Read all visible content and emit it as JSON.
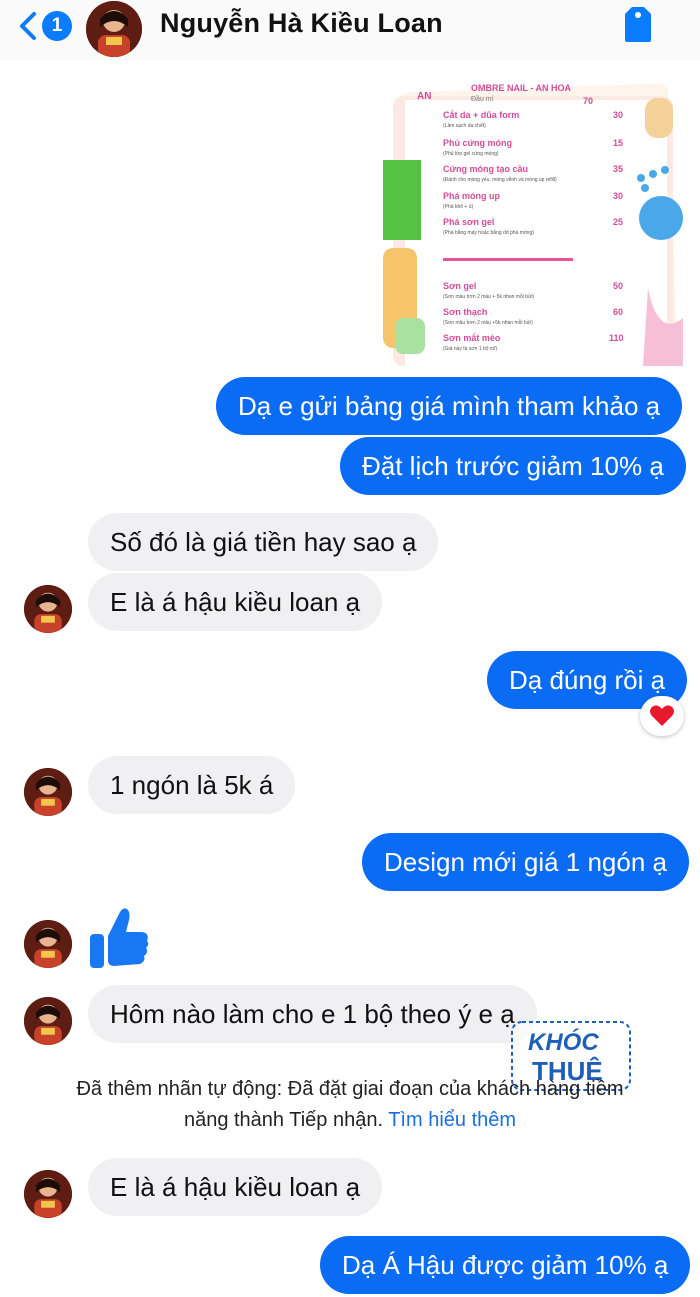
{
  "header": {
    "unread_count": "1",
    "contact_name": "Nguyễn Hà Kiều Loan",
    "back_icon": "chevron-left-icon",
    "action_icon": "tag-icon"
  },
  "price_list": {
    "header_left": "AN",
    "header_title": "OMBRE NAIL - AN HOA",
    "header_sub": "Đầu mí",
    "header_price": "70",
    "items": [
      {
        "name": "Cắt da + dũa form",
        "note": "(Làm sạch da chết)",
        "price": "30"
      },
      {
        "name": "Phủ cứng móng",
        "note": "(Phủ lớp gel cứng móng)",
        "price": "15"
      },
      {
        "name": "Cứng móng tạo cầu",
        "note": "(Đánh cho móng yếu, móng vểnh và móng up refill)",
        "price": "35"
      },
      {
        "name": "Phá móng up",
        "note": "(Phá khô + ủ)",
        "price": "30"
      },
      {
        "name": "Phá sơn gel",
        "note": "(Phá bằng máy hoặc bằng dd phá móng)",
        "price": "25"
      },
      {
        "name": "Sơn gel",
        "note": "(Sơn màu trơn 2 màu + 5k nhan mỗi bửi)",
        "price": "50"
      },
      {
        "name": "Sơn thạch",
        "note": "(Sơn màu trơn 2 màu +5k nhan mỗi bửi)",
        "price": "60"
      },
      {
        "name": "Sơn mắt mèo",
        "note": "(Giá này tà sơn 1 bộ mĩ)",
        "price": "110"
      }
    ]
  },
  "messages": [
    {
      "text": "Dạ e gửi bảng giá mình tham khảo ạ"
    },
    {
      "text": "Đặt lịch trước giảm 10% ạ"
    },
    {
      "text": "Số đó là giá tiền hay sao ạ"
    },
    {
      "text": "E là á hậu kiều loan ạ"
    },
    {
      "text": "Dạ đúng rồi ạ"
    },
    {
      "text": "1 ngón là 5k á"
    },
    {
      "text": "Design mới giá 1 ngón ạ"
    },
    {
      "text": "Hôm nào làm cho e 1 bộ theo ý e ạ"
    },
    {
      "text": "E là á hậu kiều loan ạ"
    },
    {
      "text": "Dạ Á Hậu được giảm 10% ạ"
    }
  ],
  "reaction": "heart-icon",
  "sticker": "thumbs-up-icon",
  "system_notice": {
    "line1": "Đã thêm nhãn tự động: Đã đặt giai đoạn của khách hàng tiềm",
    "line2": "năng thành Tiếp nhận.",
    "link": "Tìm hiểu thêm"
  },
  "watermark": {
    "line1": "KHÓC",
    "line2": "THUÊ"
  },
  "colors": {
    "accent": "#0a6cf5",
    "incoming": "#f0f0f2",
    "link": "#1a6fe0"
  }
}
